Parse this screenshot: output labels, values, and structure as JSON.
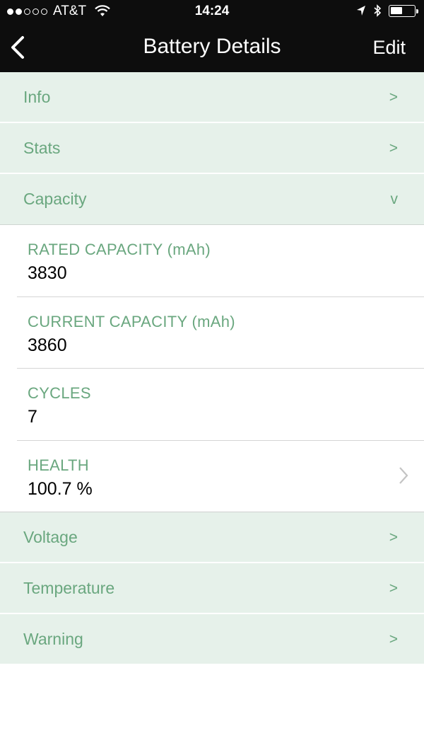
{
  "status_bar": {
    "carrier": "AT&T",
    "time": "14:24",
    "signal_filled": 2,
    "signal_total": 5
  },
  "nav": {
    "title": "Battery Details",
    "edit_label": "Edit",
    "back_icon": "chevron-left-icon"
  },
  "sections": {
    "info": {
      "label": "Info",
      "chevron": ">"
    },
    "stats": {
      "label": "Stats",
      "chevron": ">"
    },
    "capacity": {
      "label": "Capacity",
      "chevron": "v"
    },
    "voltage": {
      "label": "Voltage",
      "chevron": ">"
    },
    "temperature": {
      "label": "Temperature",
      "chevron": ">"
    },
    "warning": {
      "label": "Warning",
      "chevron": ">"
    }
  },
  "capacity_details": {
    "rated": {
      "label": "RATED CAPACITY (mAh)",
      "value": "3830"
    },
    "current": {
      "label": "CURRENT CAPACITY (mAh)",
      "value": "3860"
    },
    "cycles": {
      "label": "CYCLES",
      "value": "7"
    },
    "health": {
      "label": "HEALTH",
      "value": "100.7 %"
    }
  },
  "colors": {
    "accent": "#6aa77f",
    "section_bg": "#e6f1ea",
    "bar_bg": "#0d0d0d"
  }
}
